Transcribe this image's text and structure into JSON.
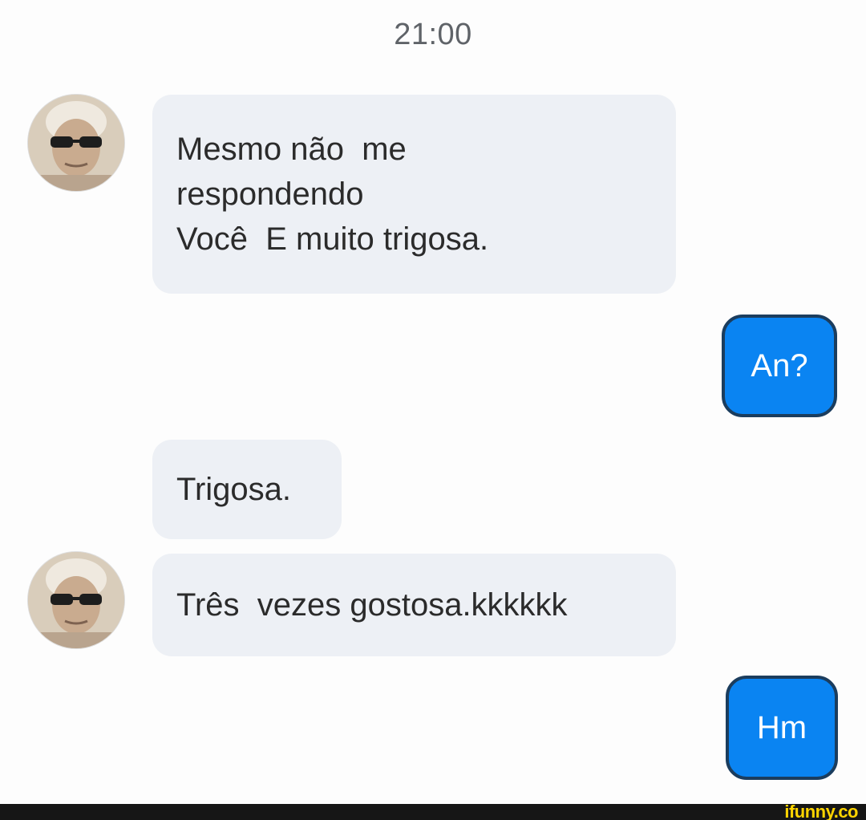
{
  "timestamp": "21:00",
  "messages": [
    {
      "direction": "incoming",
      "lines": [
        "Mesmo não  me",
        "respondendo",
        "Você  E muito trigosa."
      ]
    },
    {
      "direction": "outgoing",
      "lines": [
        "An?"
      ]
    },
    {
      "direction": "incoming",
      "lines": [
        "Trigosa."
      ]
    },
    {
      "direction": "incoming",
      "lines": [
        "Três  vezes gostosa.kkkkkk"
      ]
    },
    {
      "direction": "outgoing",
      "lines": [
        "Hm"
      ]
    }
  ],
  "watermark": "ifunny.co",
  "colors": {
    "incoming_bubble": "#edf0f5",
    "outgoing_bubble": "#0a84f2",
    "footer_bar": "#161616",
    "watermark": "#ffd400"
  },
  "icons": {
    "contact_avatar": "person-with-sunglasses-avatar"
  }
}
